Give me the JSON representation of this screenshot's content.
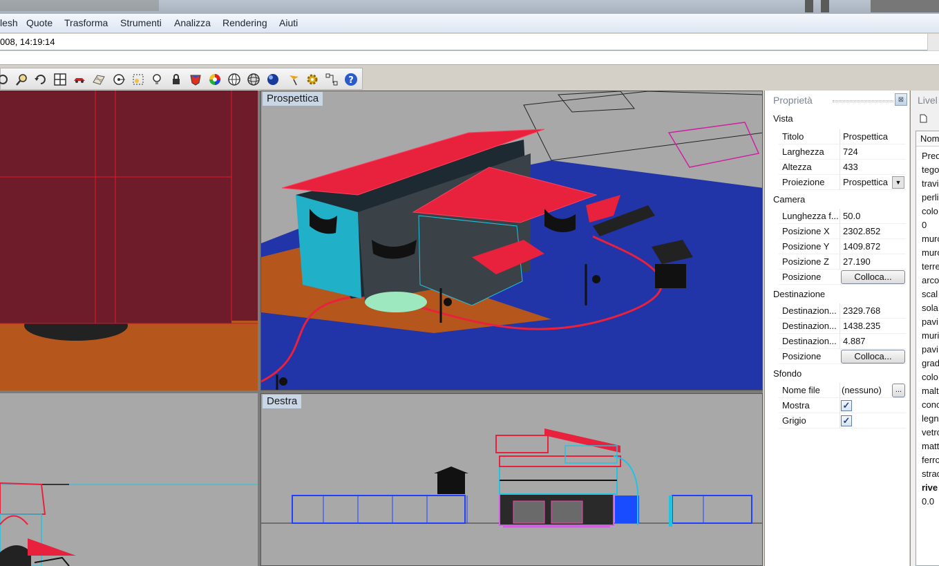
{
  "menu": [
    "lesh",
    "Quote",
    "Trasforma",
    "Strumenti",
    "Analizza",
    "Rendering",
    "Aiuti"
  ],
  "command_history": "008, 14:19:14",
  "toolbar_icons": [
    "pan-icon",
    "zoom-icon",
    "rotate-view-icon",
    "four-viewports-icon",
    "car-icon",
    "grid-icon",
    "target-icon",
    "zoom-extents-icon",
    "light-bulb-icon",
    "lock-icon",
    "shade-icon",
    "color-wheel-icon",
    "sphere-wire-icon",
    "sphere-grid-icon",
    "render-sphere-icon",
    "flag-icon",
    "gear-icon",
    "network-icon",
    "help-icon"
  ],
  "viewports": {
    "top_left": "",
    "perspective": "Prospettica",
    "bottom_left": "",
    "right": "Destra"
  },
  "properties": {
    "title": "Proprietà",
    "close": "⊠",
    "sections": {
      "vista": "Vista",
      "camera": "Camera",
      "destinazione": "Destinazione",
      "sfondo": "Sfondo"
    },
    "vista": {
      "titolo_k": "Titolo",
      "titolo_v": "Prospettica",
      "larghezza_k": "Larghezza",
      "larghezza_v": "724",
      "altezza_k": "Altezza",
      "altezza_v": "433",
      "proiezione_k": "Proiezione",
      "proiezione_v": "Prospettica"
    },
    "camera": {
      "lunghezza_k": "Lunghezza f...",
      "lunghezza_v": "50.0",
      "posx_k": "Posizione X",
      "posx_v": "2302.852",
      "posy_k": "Posizione Y",
      "posy_v": "1409.872",
      "posz_k": "Posizione Z",
      "posz_v": "27.190",
      "pos_k": "Posizione",
      "pos_btn": "Colloca..."
    },
    "destinazione": {
      "dx_k": "Destinazion...",
      "dx_v": "2329.768",
      "dy_k": "Destinazion...",
      "dy_v": "1438.235",
      "dz_k": "Destinazion...",
      "dz_v": "4.887",
      "pos_k": "Posizione",
      "pos_btn": "Colloca..."
    },
    "sfondo": {
      "nomefile_k": "Nome file",
      "nomefile_v": "(nessuno)",
      "browse": "...",
      "mostra_k": "Mostra",
      "mostra_checked": true,
      "grigio_k": "Grigio",
      "grigio_checked": true
    }
  },
  "layers": {
    "title": "Livel",
    "column": "Nom",
    "items": [
      "Pred",
      "tego",
      "travi",
      "perli",
      "colo",
      "0",
      "muro",
      "muro",
      "terre",
      "arco",
      "scal",
      "sola",
      "pavi",
      "muri",
      "pavi",
      "grad",
      "colo",
      "malt",
      "conc",
      "legn",
      "vetro",
      "matt",
      "ferro",
      "strac",
      "rive",
      "0.0"
    ]
  },
  "colors": {
    "roof_red": "#e8213c",
    "wall_cyan": "#20c4e0",
    "ground_blue": "#2134a8",
    "terrain_orange": "#b5561c",
    "viewport_gray": "#a8a8a8",
    "maroon": "#6e1c2a"
  }
}
